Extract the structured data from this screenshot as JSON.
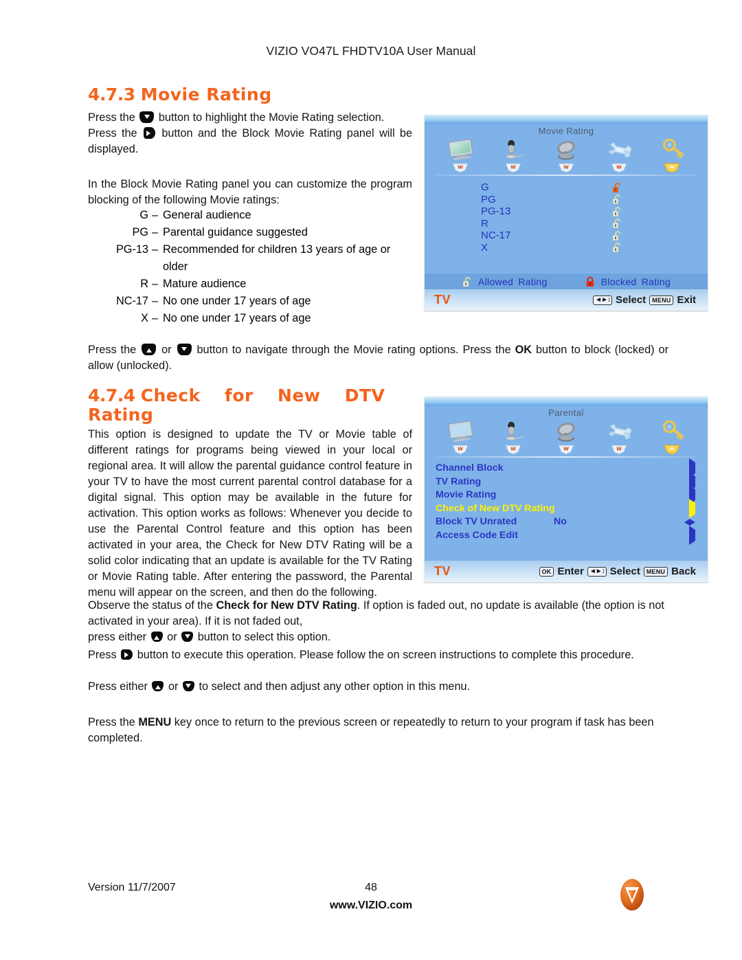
{
  "document": {
    "header_title": "VIZIO VO47L FHDTV10A User Manual",
    "footer": {
      "version": "Version 11/7/2007",
      "page_number": "48",
      "website": "www.VIZIO.com",
      "logo_letter": "V"
    }
  },
  "sections": {
    "movie_rating": {
      "number": "4.7.3",
      "title": "Movie Rating",
      "intro_1a": "Press the",
      "intro_1b": "button to highlight the Movie Rating selection.",
      "intro_2a": "Press the",
      "intro_2b": "button and the Block Movie Rating panel will be displayed.",
      "intro_3": "In the Block Movie Rating panel you can customize the program blocking of the following Movie ratings:",
      "ratings": [
        {
          "term": "G",
          "dash": "–",
          "definition": "General audience",
          "continuation": ""
        },
        {
          "term": "PG",
          "dash": "–",
          "definition": "Parental guidance suggested",
          "continuation": ""
        },
        {
          "term": "PG-13",
          "dash": "–",
          "definition": "Recommended for children 13 years of age or",
          "continuation": "older"
        },
        {
          "term": "R",
          "dash": "–",
          "definition": "Mature audience",
          "continuation": ""
        },
        {
          "term": "NC-17",
          "dash": "–",
          "definition": "No one under 17 years of age",
          "continuation": ""
        },
        {
          "term": "X",
          "dash": "–",
          "definition": "No one under 17 years of age",
          "continuation": ""
        }
      ],
      "navigate_a": "Press the",
      "navigate_or": "or",
      "navigate_b": "button to navigate through the Movie rating options.  Press the",
      "navigate_ok": "OK",
      "navigate_c": "button to block (locked) or allow (unlocked)."
    },
    "check_new_dtv": {
      "number": "4.7.4",
      "title": "Check for New DTV",
      "title_line2": "Rating",
      "paragraph": "This option is designed to update the TV or Movie table of different ratings for programs being viewed in your local or regional area. It will allow the parental guidance control feature in your TV to have the most current parental control database for a digital signal. This option may be available in the future for activation. This option works as follows: Whenever you decide to use the Parental Control feature and this option has been activated in your area, the Check for New DTV Rating will be a solid color indicating that an update is available for the TV Rating or Movie Rating table. After entering the password, the Parental menu will appear on the screen, and then do the following.",
      "observe_a": "Observe the status of the",
      "observe_bold": "Check for New DTV Rating",
      "observe_b": ". If option is faded out, no update is available (the option is not activated in your area). If it is not faded out,",
      "press_either_a": "press either",
      "press_either_or": "or",
      "press_either_b": "button to select this option.",
      "press_exec_a": "Press",
      "press_exec_b": "button to execute this operation. Please follow the on screen instructions to complete this procedure.",
      "press_adjust_a": "Press either",
      "press_adjust_or": "or",
      "press_adjust_b": "to select and then adjust any other option in this menu.",
      "menu_note_a": "Press the",
      "menu_note_bold": "MENU",
      "menu_note_b": "key once to return to the previous screen or repeatedly to return to your program if task has been completed."
    }
  },
  "osd_movie_rating": {
    "title": "Movie Rating",
    "tabs": [
      {
        "icon": "tv-monitor-icon",
        "name": "tv-tab"
      },
      {
        "icon": "microphone-icon",
        "name": "audio-tab"
      },
      {
        "icon": "satellite-dish-icon",
        "name": "tuner-tab"
      },
      {
        "icon": "wrench-icon",
        "name": "setup-tab"
      },
      {
        "icon": "key-icon",
        "name": "parental-tab"
      }
    ],
    "active_tab_index": 4,
    "rows": [
      {
        "label": "G",
        "lock_state": "unlocked",
        "selected": true
      },
      {
        "label": "PG",
        "lock_state": "unlocked",
        "selected": false
      },
      {
        "label": "PG-13",
        "lock_state": "unlocked",
        "selected": false
      },
      {
        "label": "R",
        "lock_state": "unlocked",
        "selected": false
      },
      {
        "label": "NC-17",
        "lock_state": "unlocked",
        "selected": false
      },
      {
        "label": "X",
        "lock_state": "unlocked",
        "selected": false
      }
    ],
    "legend": {
      "allowed_label": "Allowed  Rating",
      "blocked_label": "Blocked  Rating"
    },
    "status_bar": {
      "source": "TV",
      "nav_key": "◄►↕",
      "select_label": "Select",
      "menu_key": "MENU",
      "exit_label": "Exit"
    }
  },
  "osd_parental": {
    "title": "Parental",
    "tabs": [
      {
        "icon": "tv-monitor-icon",
        "name": "tv-tab"
      },
      {
        "icon": "microphone-icon",
        "name": "audio-tab"
      },
      {
        "icon": "satellite-dish-icon",
        "name": "tuner-tab"
      },
      {
        "icon": "wrench-icon",
        "name": "setup-tab"
      },
      {
        "icon": "key-icon",
        "name": "parental-tab"
      }
    ],
    "active_tab_index": 4,
    "menu_items": [
      {
        "label": "Channel Block",
        "value": "",
        "arrow": "right",
        "highlighted": false
      },
      {
        "label": "TV Rating",
        "value": "",
        "arrow": "right",
        "highlighted": false
      },
      {
        "label": "Movie Rating",
        "value": "",
        "arrow": "right",
        "highlighted": false
      },
      {
        "label": "Check of New DTV Rating",
        "value": "",
        "arrow": "right",
        "highlighted": true
      },
      {
        "label": "Block TV Unrated",
        "value": "No",
        "arrow": "leftright",
        "highlighted": false
      },
      {
        "label": "Access Code Edit",
        "value": "",
        "arrow": "right",
        "highlighted": false
      }
    ],
    "status_bar": {
      "source": "TV",
      "ok_key": "OK",
      "enter_label": "Enter",
      "nav_key": "◄►↕",
      "select_label": "Select",
      "menu_key": "MENU",
      "back_label": "Back"
    }
  },
  "colors": {
    "heading_orange": "#F4641E",
    "osd_background_blue": "#7FB2E8",
    "osd_text_blue": "#2A35C4",
    "osd_highlight_yellow": "#FFF200",
    "osd_source_orange": "#E8540F",
    "vizio_logo_orange": "#E06A1E"
  }
}
